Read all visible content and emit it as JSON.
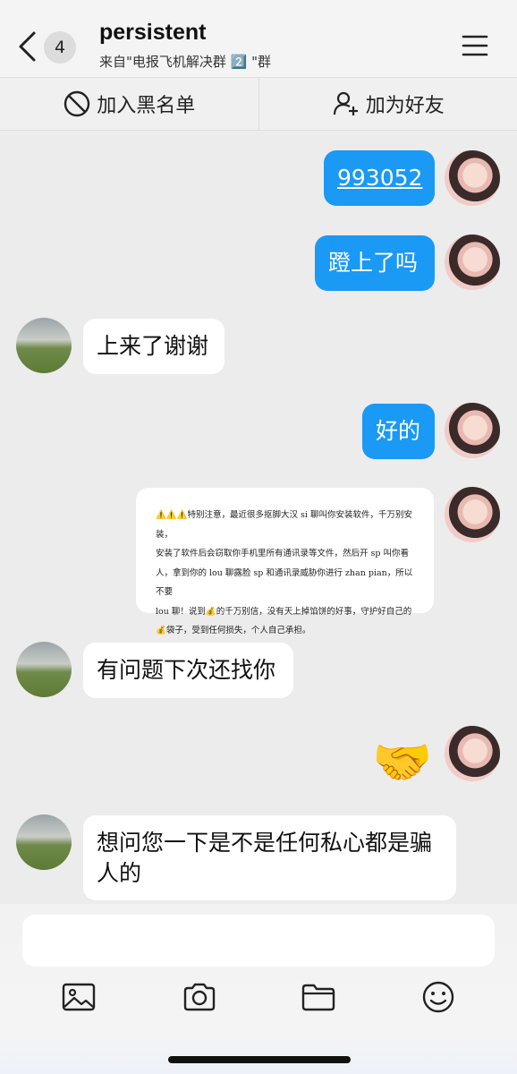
{
  "header": {
    "back_count": "4",
    "title": "persistent",
    "subtitle": "来自\"电报飞机解决群 2️⃣ \"群"
  },
  "actions": {
    "block_label": "加入黑名单",
    "add_friend_label": "加为好友"
  },
  "messages": [
    {
      "sender": "me",
      "type": "link",
      "text": "993052"
    },
    {
      "sender": "me",
      "type": "text",
      "text": "蹬上了吗"
    },
    {
      "sender": "them",
      "type": "text",
      "text": "上来了谢谢"
    },
    {
      "sender": "me",
      "type": "text",
      "text": "好的"
    },
    {
      "sender": "me",
      "type": "notice",
      "lines": [
        "⚠️⚠️⚠️特别注意，最近很多抠脚大汉 si 聊叫你安装软件，千万别安装，",
        "安装了软件后会窃取你手机里所有通讯录等文件，然后开 sp 叫你看",
        "人，拿到你的 lou 聊露脸 sp 和通讯录威胁你进行 zhan pian，所以不要",
        "lou 聊！说到💰的千万别信，没有天上掉馅饼的好事，守护好自己的",
        "💰袋子，受到任何损失，个人自己承担。"
      ]
    },
    {
      "sender": "them",
      "type": "text",
      "text": "有问题下次还找你"
    },
    {
      "sender": "me",
      "type": "emoji",
      "text": "🤝"
    },
    {
      "sender": "them",
      "type": "text",
      "lines": [
        "想问您一下是不是任何私心都是骗",
        "人的"
      ]
    }
  ],
  "composer": {
    "value": ""
  },
  "toolbar": [
    "image-icon",
    "camera-icon",
    "folder-icon",
    "emoji-icon"
  ]
}
